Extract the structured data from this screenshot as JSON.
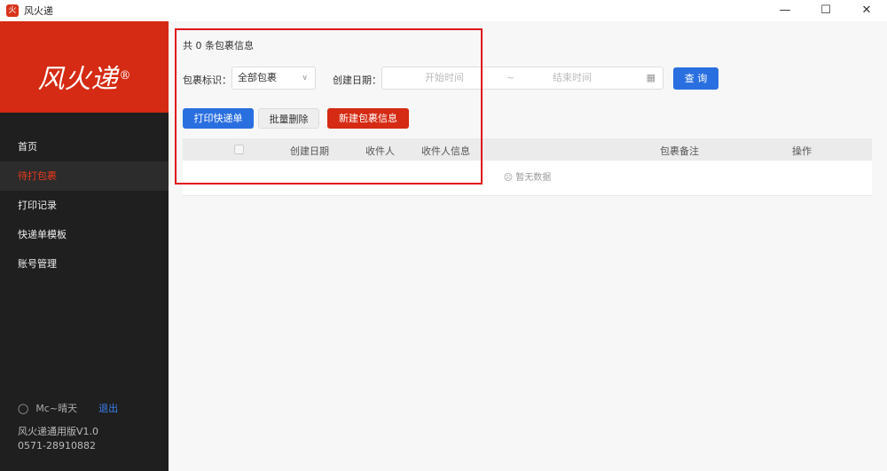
{
  "window": {
    "title": "风火递",
    "app_icon": "火",
    "minimize": "—",
    "maximize": "☐",
    "close": "✕"
  },
  "sidebar": {
    "logo": "风火递",
    "logo_mark": "®",
    "items": [
      {
        "label": "首页"
      },
      {
        "label": "待打包裹"
      },
      {
        "label": "打印记录"
      },
      {
        "label": "快递单模板"
      },
      {
        "label": "账号管理"
      }
    ],
    "user": "Mc~晴天",
    "logout": "退出",
    "version": "风火递通用版V1.0",
    "phone": "0571-28910882"
  },
  "main": {
    "count": "共 0 条包裹信息",
    "filter_label": "包裹标识：",
    "filter_value": "全部包裹",
    "date_label": "创建日期：",
    "start_placeholder": "开始时间",
    "sep": "~",
    "end_placeholder": "结束时间",
    "query": "查 询",
    "print": "打印快递单",
    "batch_delete": "批量删除",
    "new": "新建包裹信息",
    "columns": [
      "创建日期",
      "收件人",
      "收件人信息",
      "包裹备注",
      "操作"
    ],
    "empty": "☹ 暂无数据"
  }
}
